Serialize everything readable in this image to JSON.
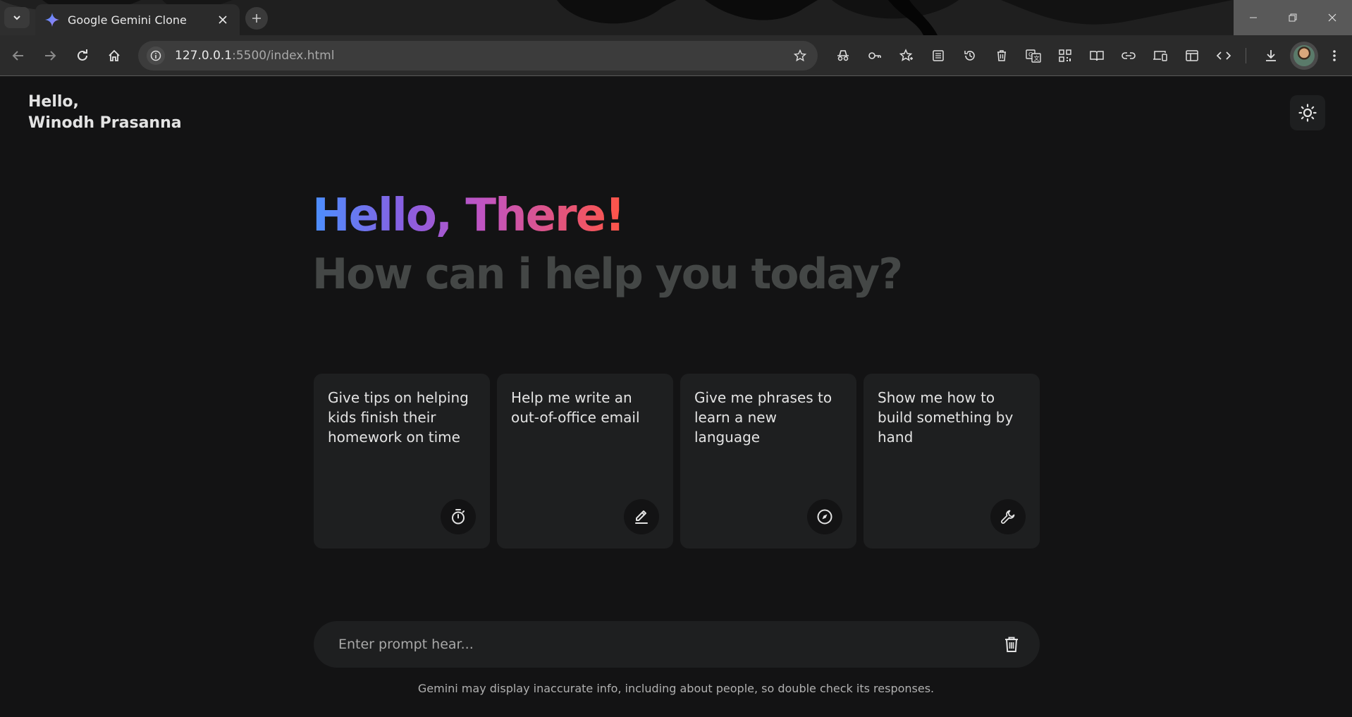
{
  "browser": {
    "tab_title": "Google Gemini Clone",
    "url_host": "127.0.0.1",
    "url_rest": ":5500/index.html"
  },
  "header": {
    "greeting_line1": "Hello,",
    "greeting_line2": "Winodh Prasanna"
  },
  "hero": {
    "title": "Hello, There!",
    "subtitle": "How can i help you today?"
  },
  "suggestions": [
    {
      "text": "Give tips on helping kids finish their homework on time",
      "icon": "timer-icon"
    },
    {
      "text": "Help me write an out-of-office email",
      "icon": "edit-icon"
    },
    {
      "text": "Give me phrases to learn a new language",
      "icon": "compass-icon"
    },
    {
      "text": "Show me how to build something by hand",
      "icon": "wrench-icon"
    }
  ],
  "prompt": {
    "placeholder": "Enter prompt hear..."
  },
  "disclaimer": "Gemini may display inaccurate info, including about people, so double check its responses.",
  "colors": {
    "background": "#131314",
    "card": "#1e1f20",
    "gradient_start": "#4b90ff",
    "gradient_end": "#ff5546",
    "subtitle": "#444746"
  }
}
